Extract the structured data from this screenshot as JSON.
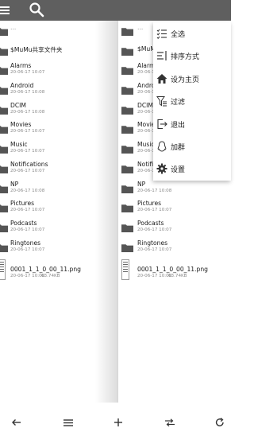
{
  "left_pane": {
    "up_label": "...",
    "items": [
      {
        "name": "$MuMu共享文件夹",
        "date": ""
      },
      {
        "name": "Alarms",
        "date": "20-06-17 10:07"
      },
      {
        "name": "Android",
        "date": "20-06-17 10:08"
      },
      {
        "name": "DCIM",
        "date": "20-06-17 10:08"
      },
      {
        "name": "Movies",
        "date": "20-06-17 10:07"
      },
      {
        "name": "Music",
        "date": "20-06-17 10:07"
      },
      {
        "name": "Notifications",
        "date": "20-06-17 10:07"
      },
      {
        "name": "NP",
        "date": "20-06-17 10:08"
      },
      {
        "name": "Pictures",
        "date": "20-06-17 10:07"
      },
      {
        "name": "Podcasts",
        "date": "20-06-17 10:07"
      },
      {
        "name": "Ringtones",
        "date": "20-06-17 10:07"
      }
    ],
    "file": {
      "name": "0001_1_1_0_00_11.png",
      "date": "20-06-17 10:08",
      "size": "63.74KB"
    }
  },
  "right_pane": {
    "up_label": "...",
    "items": [
      {
        "name": "",
        "date": ""
      },
      {
        "name": "$MuMu",
        "date": ""
      },
      {
        "name": "Alarms",
        "date": "20-06-17 10:07"
      },
      {
        "name": "Andro",
        "date": "20-06-17 10:08"
      },
      {
        "name": "DCIM",
        "date": "20-06-17 10:08"
      },
      {
        "name": "Movie",
        "date": "20-06-17 10:07"
      },
      {
        "name": "Music",
        "date": "20-06-17 10:07"
      },
      {
        "name": "Notific",
        "date": "20-06-17 10:07"
      },
      {
        "name": "NP",
        "date": "20-06-17 10:08"
      },
      {
        "name": "Pictures",
        "date": "20-06-17 10:07"
      },
      {
        "name": "Podcasts",
        "date": "20-06-17 10:07"
      },
      {
        "name": "Ringtones",
        "date": "20-06-17 10:07"
      }
    ],
    "file": {
      "name": "0001_1_1_0_00_11.png",
      "date": "20-06-17 10:08",
      "size": "63.74KB"
    }
  },
  "popup_menu": {
    "items": [
      {
        "label": "全选",
        "icon": "checklist-icon"
      },
      {
        "label": "排序方式",
        "icon": "sort-icon"
      },
      {
        "label": "设为主页",
        "icon": "home-icon"
      },
      {
        "label": "过滤",
        "icon": "filter-icon"
      },
      {
        "label": "退出",
        "icon": "exit-icon"
      },
      {
        "label": "加群",
        "icon": "qq-icon"
      },
      {
        "label": "设置",
        "icon": "gear-icon"
      }
    ]
  },
  "toolbar": {
    "icons": [
      "menu-icon",
      "search-icon"
    ]
  },
  "bottom_bar": {
    "icons": [
      "back-arrow-icon",
      "list-menu-icon",
      "add-icon",
      "swap-icon",
      "refresh-icon"
    ]
  },
  "colors": {
    "toolbar_bg": "#5f5f5f",
    "folder": "#555555",
    "accent_text": "#1a1a1a"
  }
}
